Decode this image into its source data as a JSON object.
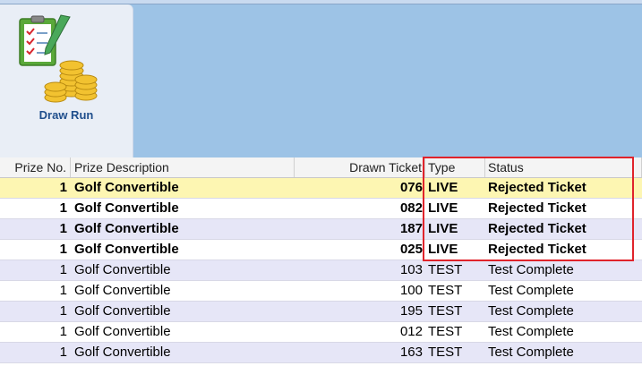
{
  "ribbon": {
    "draw_run": {
      "label": "Draw Run",
      "icon": "clipboard-coins-icon"
    }
  },
  "grid": {
    "columns": [
      "Prize No.",
      "Prize Description",
      "Drawn Ticket",
      "Type",
      "Status"
    ],
    "rows": [
      {
        "prize_no": "1",
        "description": "Golf Convertible",
        "ticket": "076",
        "type": "LIVE",
        "status": "Rejected Ticket",
        "bold": true,
        "bg": "#fdf6b2"
      },
      {
        "prize_no": "1",
        "description": "Golf Convertible",
        "ticket": "082",
        "type": "LIVE",
        "status": "Rejected Ticket",
        "bold": true,
        "bg": "#ffffff"
      },
      {
        "prize_no": "1",
        "description": "Golf Convertible",
        "ticket": "187",
        "type": "LIVE",
        "status": "Rejected Ticket",
        "bold": true,
        "bg": "#e6e6f7"
      },
      {
        "prize_no": "1",
        "description": "Golf Convertible",
        "ticket": "025",
        "type": "LIVE",
        "status": "Rejected Ticket",
        "bold": true,
        "bg": "#ffffff"
      },
      {
        "prize_no": "1",
        "description": "Golf Convertible",
        "ticket": "103",
        "type": "TEST",
        "status": "Test Complete",
        "bold": false,
        "bg": "#e6e6f7"
      },
      {
        "prize_no": "1",
        "description": "Golf Convertible",
        "ticket": "100",
        "type": "TEST",
        "status": "Test Complete",
        "bold": false,
        "bg": "#ffffff"
      },
      {
        "prize_no": "1",
        "description": "Golf Convertible",
        "ticket": "195",
        "type": "TEST",
        "status": "Test Complete",
        "bold": false,
        "bg": "#e6e6f7"
      },
      {
        "prize_no": "1",
        "description": "Golf Convertible",
        "ticket": "012",
        "type": "TEST",
        "status": "Test Complete",
        "bold": false,
        "bg": "#ffffff"
      },
      {
        "prize_no": "1",
        "description": "Golf Convertible",
        "ticket": "163",
        "type": "TEST",
        "status": "Test Complete",
        "bold": false,
        "bg": "#e6e6f7"
      }
    ]
  },
  "highlight_color": "#e0232b"
}
